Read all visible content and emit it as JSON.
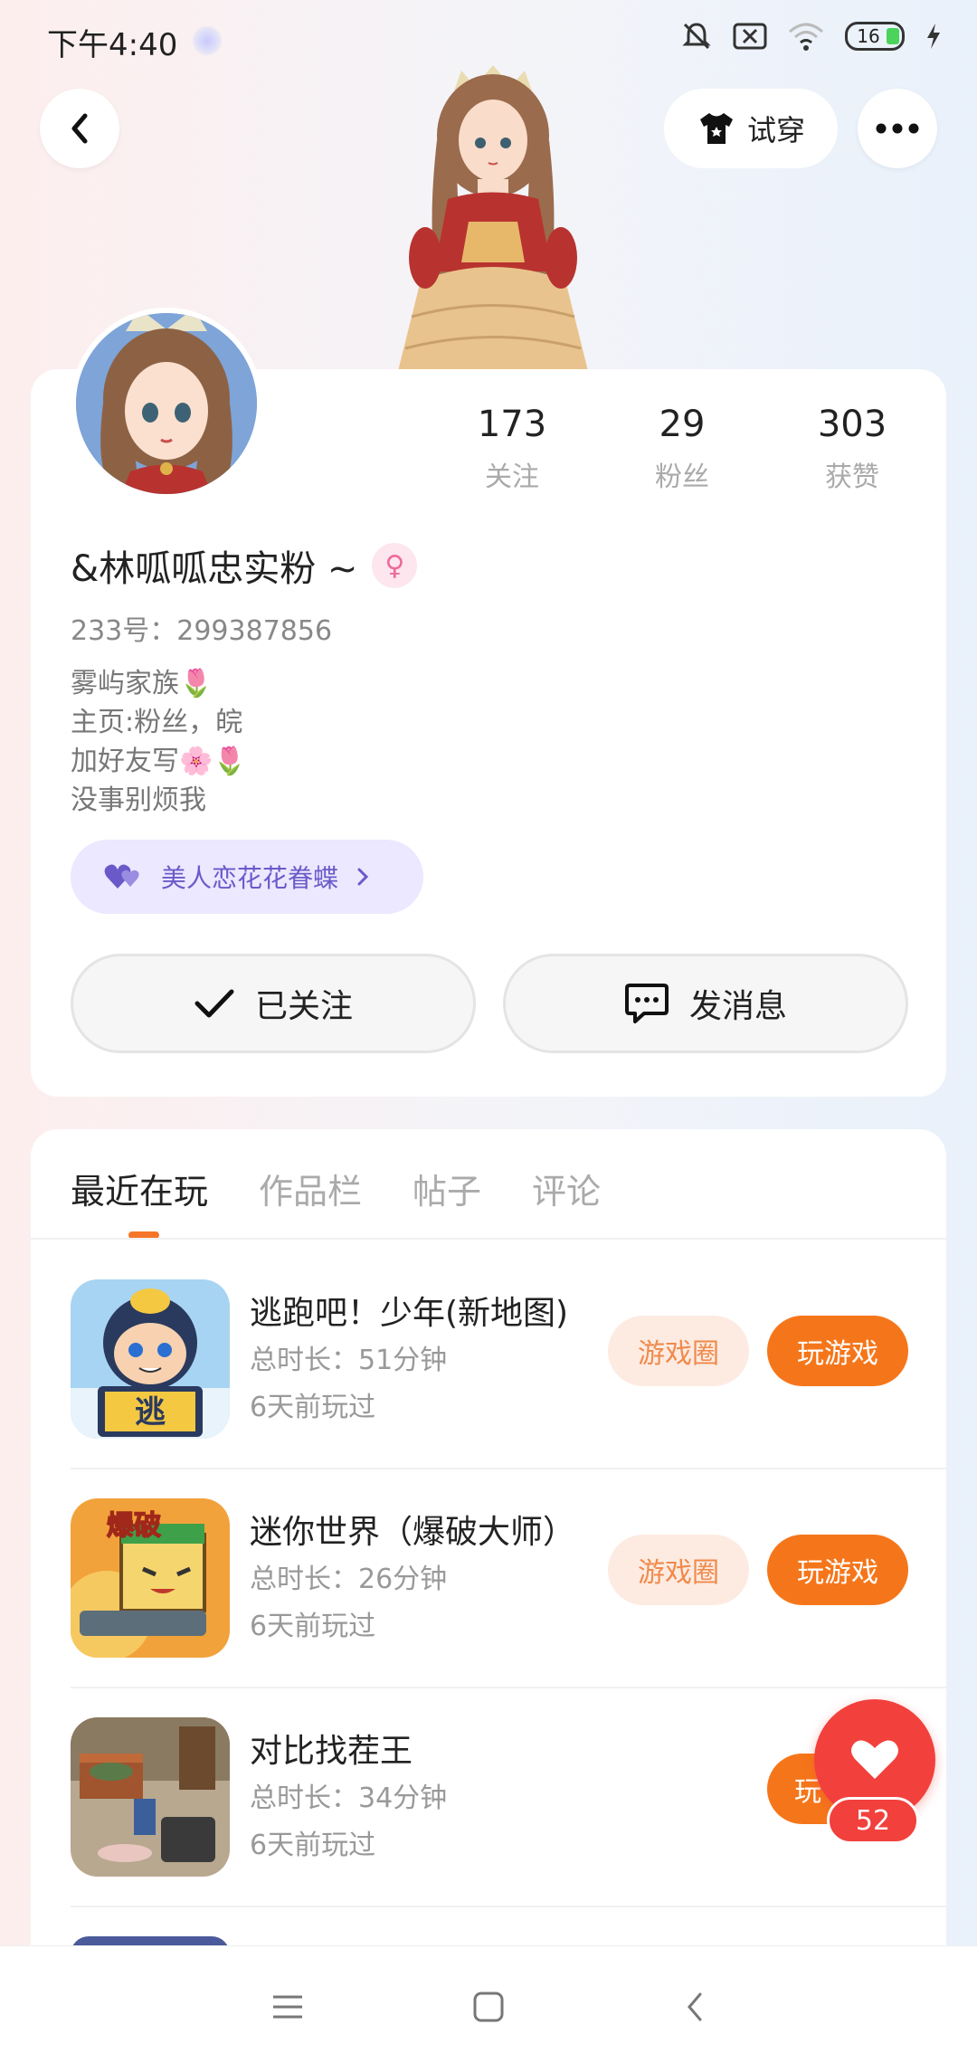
{
  "status_bar": {
    "time": "下午4:40",
    "battery": "16"
  },
  "header": {
    "try_on_label": "试穿"
  },
  "profile": {
    "stats": [
      {
        "value": "173",
        "label": "关注"
      },
      {
        "value": "29",
        "label": "粉丝"
      },
      {
        "value": "303",
        "label": "获赞"
      }
    ],
    "username": "&林呱呱忠实粉 ~",
    "id_line": "233号：299387856",
    "bio_lines": [
      "雾屿家族🌷",
      "主页:粉丝，皖",
      "加好友写🌸🌷",
      "没事别烦我"
    ],
    "family_label": "美人恋花花眷蝶",
    "follow_label": "已关注",
    "message_label": "发消息"
  },
  "tabs": [
    {
      "label": "最近在玩",
      "active": true
    },
    {
      "label": "作品栏",
      "active": false
    },
    {
      "label": "帖子",
      "active": false
    },
    {
      "label": "评论",
      "active": false
    }
  ],
  "games": [
    {
      "title": "逃跑吧！少年(新地图)",
      "duration": "总时长：51分钟",
      "last_played": "6天前玩过",
      "circle_label": "游戏圈",
      "play_label": "玩游戏"
    },
    {
      "title": "迷你世界（爆破大师）",
      "duration": "总时长：26分钟",
      "last_played": "6天前玩过",
      "circle_label": "游戏圈",
      "play_label": "玩游戏"
    },
    {
      "title": "对比找茬王",
      "duration": "总时长：34分钟",
      "last_played": "6天前玩过",
      "circle_label": "",
      "play_label": "玩"
    }
  ],
  "like_float": {
    "count": "52"
  },
  "colors": {
    "accent": "#f5761a",
    "like": "#f2403c",
    "family": "#6a5ac9"
  }
}
